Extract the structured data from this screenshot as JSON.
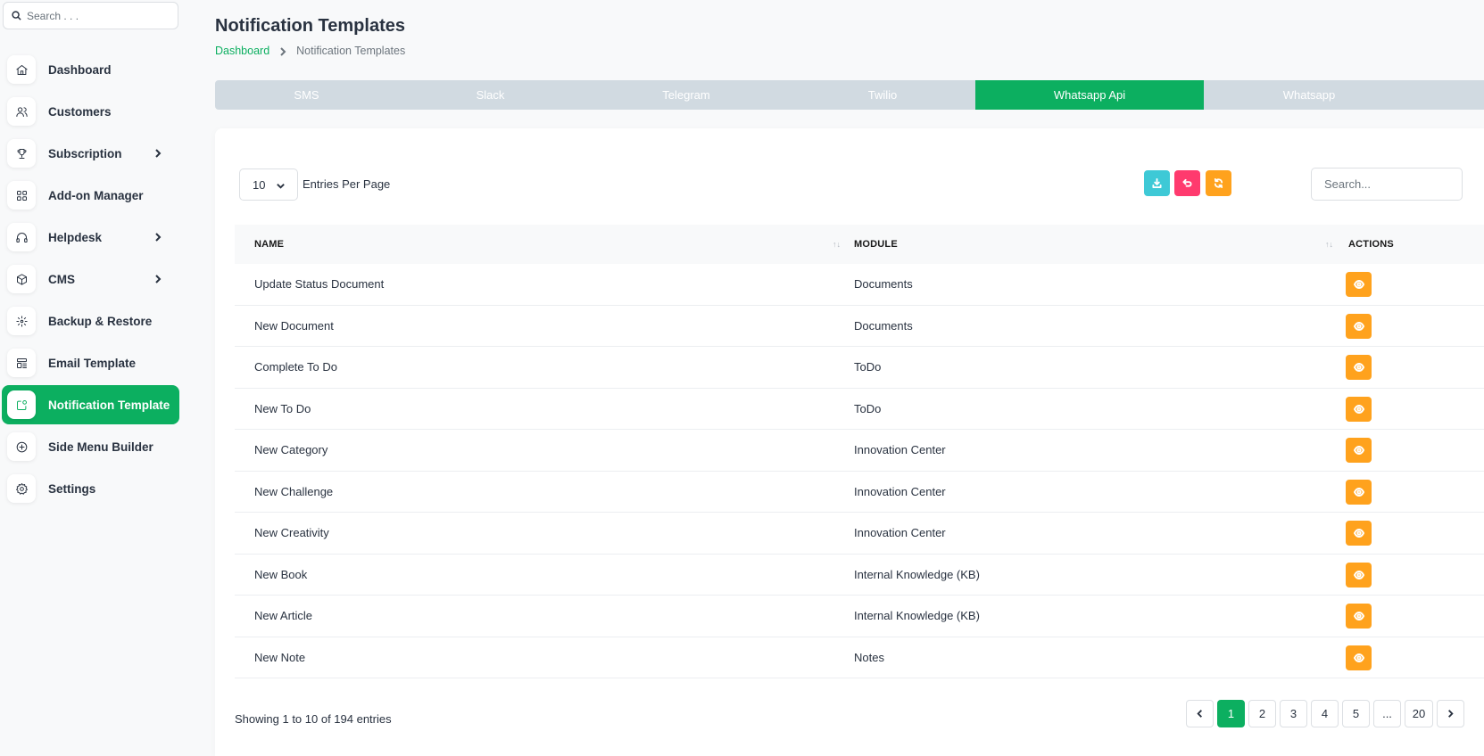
{
  "colors": {
    "accent": "#0caf60",
    "tab_bg": "#d1dae1",
    "view_btn": "#ffa21d",
    "download_btn": "#3ec9d6",
    "reset_btn": "#ff3a6e",
    "refresh_btn": "#ffa21d"
  },
  "sidebar": {
    "search_placeholder": "Search . . .",
    "items": [
      {
        "label": "Dashboard",
        "icon": "home-icon"
      },
      {
        "label": "Customers",
        "icon": "users-icon"
      },
      {
        "label": "Subscription",
        "icon": "trophy-icon",
        "has_children": true
      },
      {
        "label": "Add-on Manager",
        "icon": "apps-icon"
      },
      {
        "label": "Helpdesk",
        "icon": "headset-icon",
        "has_children": true
      },
      {
        "label": "CMS",
        "icon": "package-icon",
        "has_children": true
      },
      {
        "label": "Backup & Restore",
        "icon": "backup-icon"
      },
      {
        "label": "Email Template",
        "icon": "template-icon"
      },
      {
        "label": "Notification Template",
        "icon": "notification-icon",
        "active": true
      },
      {
        "label": "Side Menu Builder",
        "icon": "plus-circle-icon"
      },
      {
        "label": "Settings",
        "icon": "gear-icon"
      }
    ]
  },
  "header": {
    "title": "Notification Templates",
    "breadcrumb": {
      "home": "Dashboard",
      "current": "Notification Templates"
    }
  },
  "tabs": [
    {
      "label": "SMS"
    },
    {
      "label": "Slack"
    },
    {
      "label": "Telegram"
    },
    {
      "label": "Twilio"
    },
    {
      "label": "Whatsapp Api",
      "active": true
    },
    {
      "label": "Whatsapp"
    }
  ],
  "toolbar": {
    "per_page_value": "10",
    "per_page_label": "Entries Per Page",
    "search_placeholder": "Search..."
  },
  "table": {
    "headers": {
      "name": "NAME",
      "module": "MODULE",
      "actions": "ACTIONS"
    },
    "rows": [
      {
        "name": "Update Status Document",
        "module": "Documents"
      },
      {
        "name": "New Document",
        "module": "Documents"
      },
      {
        "name": "Complete To Do",
        "module": "ToDo"
      },
      {
        "name": "New To Do",
        "module": "ToDo"
      },
      {
        "name": "New Category",
        "module": "Innovation Center"
      },
      {
        "name": "New Challenge",
        "module": "Innovation Center"
      },
      {
        "name": "New Creativity",
        "module": "Innovation Center"
      },
      {
        "name": "New Book",
        "module": "Internal Knowledge (KB)"
      },
      {
        "name": "New Article",
        "module": "Internal Knowledge (KB)"
      },
      {
        "name": "New Note",
        "module": "Notes"
      }
    ]
  },
  "footer": {
    "showing": "Showing 1 to 10 of 194 entries",
    "pages": [
      "1",
      "2",
      "3",
      "4",
      "5",
      "...",
      "20"
    ],
    "current_page": "1"
  }
}
